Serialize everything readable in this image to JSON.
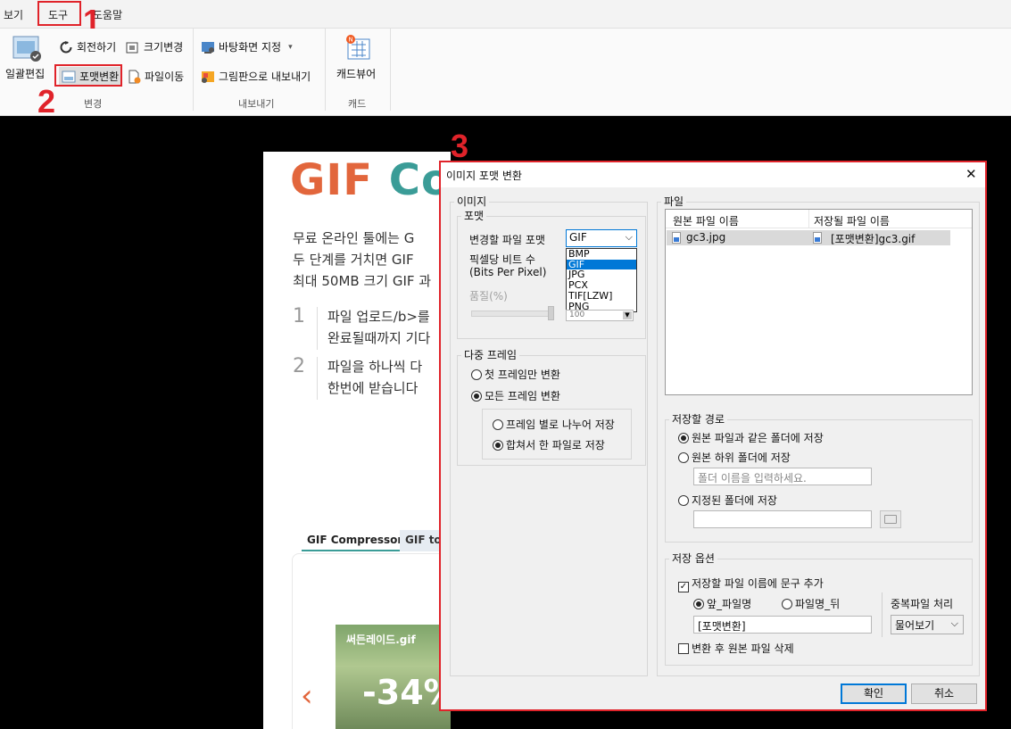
{
  "menu": {
    "view": "보기",
    "tools": "도구",
    "help": "도움말"
  },
  "annotations": {
    "n1": "1",
    "n2": "2",
    "n3": "3"
  },
  "ribbon": {
    "batch_edit": "일괄편집",
    "rotate": "회전하기",
    "resize": "크기변경",
    "format_convert": "포맷변환",
    "file_move": "파일이동",
    "set_wallpaper": "바탕화면 지정",
    "export_clipboard": "그림판으로 내보내기",
    "card_viewer": "캐드뷰어",
    "group_change": "변경",
    "group_export": "내보내기",
    "group_cad": "캐드"
  },
  "webpage": {
    "title": "GIF Co",
    "p1": "무료 온라인 툴에는 G",
    "p2": "두 단계를 거치면 GIF",
    "p3": "최대 50MB 크기 GIF 과",
    "step1_num": "1",
    "step1_a": "파일 업로드/b>를",
    "step1_b": "완료될때까지 기다",
    "step2_num": "2",
    "step2_a": "파일을 하나씩 다",
    "step2_b": "한번에 받습니다",
    "tab1": "GIF Compressor",
    "tab2": "GIF to",
    "thumb_name": "써든레이드.gif",
    "thumb_percent": "-34%"
  },
  "dialog": {
    "title": "이미지 포맷 변환",
    "close": "✕",
    "image_group": "이미지",
    "format_group": "포맷",
    "target_format_label": "변경할 파일 포맷",
    "target_format_value": "GIF",
    "format_options": [
      "BMP",
      "GIF",
      "JPG",
      "PCX",
      "TIF[LZW]",
      "PNG"
    ],
    "format_selected": "GIF",
    "bits_label": "픽셀당 비트 수",
    "bits_sub": "(Bits Per Pixel)",
    "quality_label": "품질(%)",
    "quality_value": "100",
    "multi_frame_group": "다중 프레임",
    "first_frame_only": "첫 프레임만 변환",
    "all_frames": "모든 프레임 변환",
    "split_per_frame": "프레임 별로 나누어 저장",
    "merge_one_file": "합쳐서 한 파일로 저장",
    "file_group": "파일",
    "col_original": "원본 파일 이름",
    "col_saved": "저장될 파일 이름",
    "row_original": "gc3.jpg",
    "row_saved": "[포맷변환]gc3.gif",
    "save_path_group": "저장할 경로",
    "same_folder": "원본 파일과 같은 폴더에 저장",
    "sub_folder": "원본 하위 폴더에 저장",
    "sub_folder_placeholder": "폴더 이름을 입력하세요.",
    "specified_folder": "지정된 폴더에 저장",
    "save_options_group": "저장 옵션",
    "add_text": "저장할 파일 이름에 문구 추가",
    "front": "앞_파일명",
    "back": "파일명_뒤",
    "prefix_value": "[포맷변환]",
    "duplicate_label": "중복파일 처리",
    "duplicate_value": "물어보기",
    "delete_original": "변환 후 원본 파일 삭제",
    "ok": "확인",
    "cancel": "취소"
  },
  "colors": {
    "accent": "#e0232a",
    "select": "#0078d7",
    "gif_orange": "#e2663c",
    "gif_teal": "#3a9c97"
  }
}
